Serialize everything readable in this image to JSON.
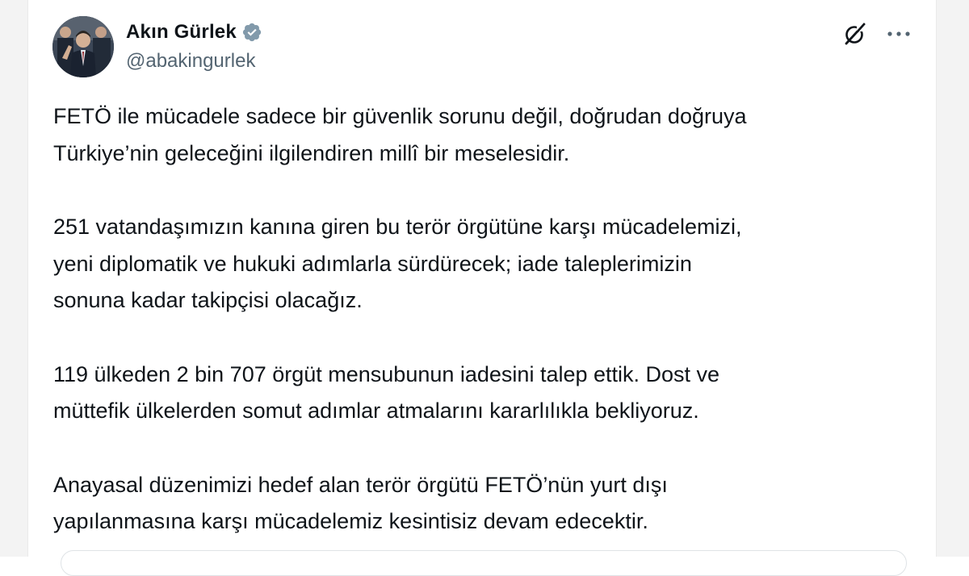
{
  "author": {
    "display_name": "Akın Gürlek",
    "handle": "@abakingurlek",
    "verified": true
  },
  "icons": {
    "avatar": "profile-photo",
    "verified": "verified-badge-icon",
    "grok": "grok-icon",
    "more": "more-options-icon"
  },
  "colors": {
    "text": "#0f1419",
    "secondary": "#536471",
    "badge": "#829aab"
  },
  "tweet": {
    "paragraphs": [
      "FETÖ ile mücadele sadece bir güvenlik sorunu değil, doğrudan doğruya\nTürkiye’nin geleceğini ilgilendiren millî bir meselesidir.",
      "251 vatandaşımızın kanına giren bu terör örgütüne karşı mücadelemizi,\nyeni diplomatik ve hukuki adımlarla sürdürecek; iade taleplerimizin\nsonuna kadar takipçisi olacağız.",
      "119 ülkeden 2 bin 707 örgüt mensubunun iadesini talep ettik. Dost ve\nmüttefik ülkelerden somut adımlar atmalarını kararlılıkla bekliyoruz.",
      "Anayasal düzenimizi hedef alan terör örgütü FETÖ’nün yurt dışı\nyapılanmasına karşı mücadelemiz kesintisiz devam edecektir."
    ]
  }
}
